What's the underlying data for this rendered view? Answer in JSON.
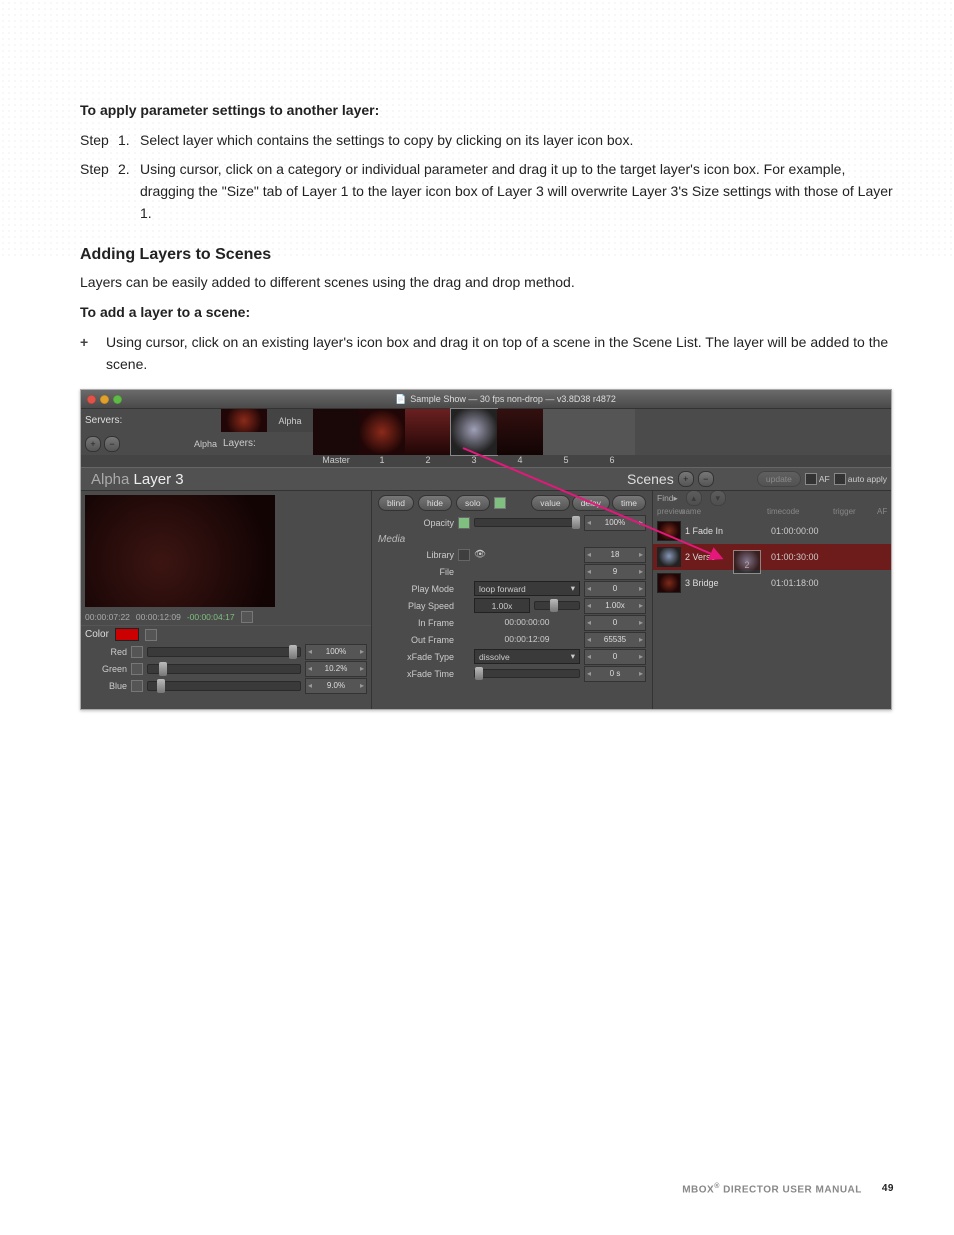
{
  "doc": {
    "para1_heading": "To apply parameter settings to another layer:",
    "step_label": "Step",
    "step1_num": "1.",
    "step1_text": "Select layer which contains the settings to copy by clicking on its layer icon box.",
    "step2_num": "2.",
    "step2_text": "Using cursor, click on a category or individual parameter and drag it up to the target layer's icon box. For example, dragging the \"Size\" tab of Layer 1 to the layer icon box of Layer 3 will overwrite Layer 3's Size settings with those of Layer 1.",
    "h3": "Adding Layers to Scenes",
    "p2": "Layers can be easily added to different scenes using the drag and drop method.",
    "para2_heading": "To add a layer to a scene:",
    "bullet_plus": "+",
    "bullet_text": "Using cursor, click on an existing layer's icon box and drag it on top of a scene in the Scene List. The layer will be added to the scene."
  },
  "shot": {
    "titlebar": "Sample Show   —   30 fps non-drop   —   v3.8D38 r4872",
    "servers_label": "Servers:",
    "layers_label": "Layers:",
    "alpha_tab1": "Alpha",
    "alpha_tab2": "Alpha",
    "layer_labels": {
      "master": "Master",
      "l1": "1",
      "l2": "2",
      "l3": "3",
      "l4": "4",
      "l5": "5",
      "l6": "6"
    },
    "header_server": "Alpha",
    "header_layer": "Layer 3",
    "tabs": {
      "value": "value",
      "delay": "delay",
      "time": "time"
    },
    "btn_blind": "blind",
    "btn_hide": "hide",
    "btn_solo": "solo",
    "tc_in": "00:00:07:22",
    "tc_dur": "00:00:12:09",
    "tc_rem": "-00:00:04:17",
    "color_label": "Color",
    "channels": {
      "red": {
        "label": "Red",
        "value": "100%"
      },
      "green": {
        "label": "Green",
        "value": "10.2%"
      },
      "blue": {
        "label": "Blue",
        "value": "9.0%"
      }
    },
    "params": {
      "opacity_label": "Opacity",
      "opacity_value": "100%",
      "media_label": "Media",
      "library_label": "Library",
      "library_value": "18",
      "file_label": "File",
      "file_value": "9",
      "playmode_label": "Play Mode",
      "playmode_value": "loop forward",
      "playmode_step": "0",
      "playspeed_label": "Play Speed",
      "playspeed_value": "1.00x",
      "playspeed_step": "1.00x",
      "inframe_label": "In Frame",
      "inframe_value": "00:00:00:00",
      "inframe_step": "0",
      "outframe_label": "Out Frame",
      "outframe_value": "00:00:12:09",
      "outframe_step": "65535",
      "xfadetype_label": "xFade Type",
      "xfadetype_value": "dissolve",
      "xfadetype_step": "0",
      "xfadetime_label": "xFade Time",
      "xfadetime_step": "0 s"
    },
    "scenes": {
      "title": "Scenes",
      "update": "update",
      "af": "AF",
      "auto_apply": "auto apply",
      "find": "Find▸",
      "cols": {
        "preview": "preview",
        "name": "name",
        "timecode": "timecode",
        "trigger": "trigger",
        "af": "AF"
      },
      "rows": [
        {
          "num": "1",
          "name": "Fade In",
          "tc": "01:00:00:00"
        },
        {
          "num": "2",
          "name": "Verse",
          "tc": "01:00:30:00"
        },
        {
          "num": "3",
          "name": "Bridge",
          "tc": "01:01:18:00"
        }
      ],
      "drag_ghost": "2"
    }
  },
  "footer": {
    "manual_text_prefix": "MBOX",
    "manual_text_suffix": " DIRECTOR USER MANUAL",
    "page": "49"
  }
}
